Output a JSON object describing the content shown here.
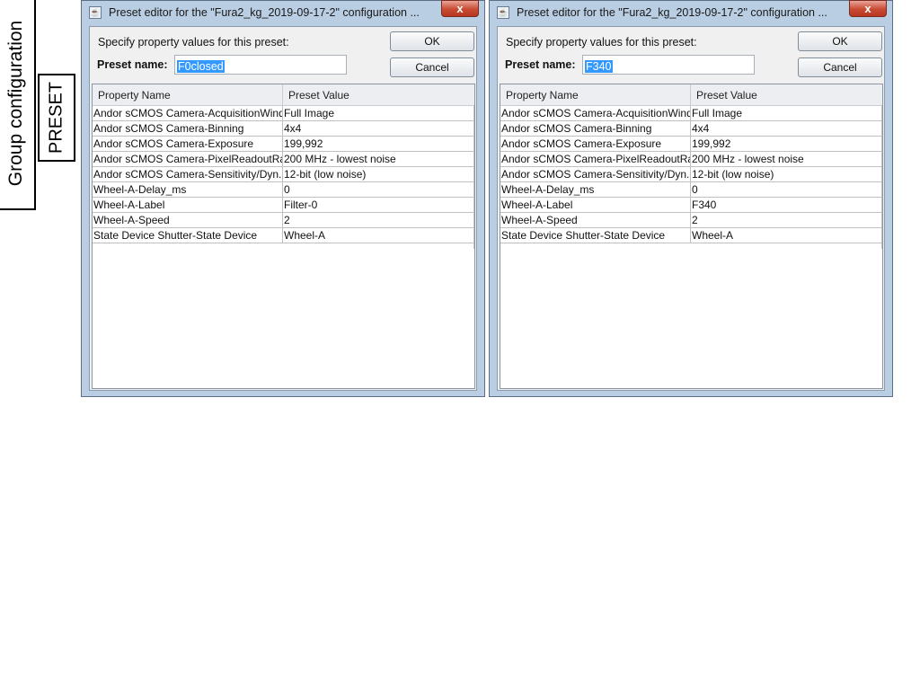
{
  "side_labels": {
    "group_configuration": "Group configuration",
    "preset": "PRESET"
  },
  "dialogs": [
    {
      "title": "Preset editor for the \"Fura2_kg_2019-09-17-2\" configuration ...",
      "close_glyph": "x",
      "instruction": "Specify property values for this preset:",
      "preset_name_label": "Preset name:",
      "preset_name_value": "F0closed",
      "ok_label": "OK",
      "cancel_label": "Cancel",
      "columns": [
        "Property Name",
        "Preset Value"
      ],
      "rows": [
        [
          "Andor sCMOS Camera-AcquisitionWind...",
          "Full Image"
        ],
        [
          "Andor sCMOS Camera-Binning",
          "4x4"
        ],
        [
          "Andor sCMOS Camera-Exposure",
          "199,992"
        ],
        [
          "Andor sCMOS Camera-PixelReadoutRate",
          "200 MHz - lowest noise"
        ],
        [
          "Andor sCMOS Camera-Sensitivity/Dyn...",
          "12-bit (low noise)"
        ],
        [
          "Wheel-A-Delay_ms",
          "0"
        ],
        [
          "Wheel-A-Label",
          "Filter-0"
        ],
        [
          "Wheel-A-Speed",
          "2"
        ],
        [
          "State Device Shutter-State Device",
          "Wheel-A"
        ]
      ]
    },
    {
      "title": "Preset editor for the \"Fura2_kg_2019-09-17-2\" configuration ...",
      "close_glyph": "x",
      "instruction": "Specify property values for this preset:",
      "preset_name_label": "Preset name:",
      "preset_name_value": "F340",
      "ok_label": "OK",
      "cancel_label": "Cancel",
      "columns": [
        "Property Name",
        "Preset Value"
      ],
      "rows": [
        [
          "Andor sCMOS Camera-AcquisitionWind...",
          "Full Image"
        ],
        [
          "Andor sCMOS Camera-Binning",
          "4x4"
        ],
        [
          "Andor sCMOS Camera-Exposure",
          "199,992"
        ],
        [
          "Andor sCMOS Camera-PixelReadoutRate",
          "200 MHz - lowest noise"
        ],
        [
          "Andor sCMOS Camera-Sensitivity/Dyn...",
          "12-bit (low noise)"
        ],
        [
          "Wheel-A-Delay_ms",
          "0"
        ],
        [
          "Wheel-A-Label",
          "F340"
        ],
        [
          "Wheel-A-Speed",
          "2"
        ],
        [
          "State Device Shutter-State Device",
          "Wheel-A"
        ]
      ]
    }
  ]
}
